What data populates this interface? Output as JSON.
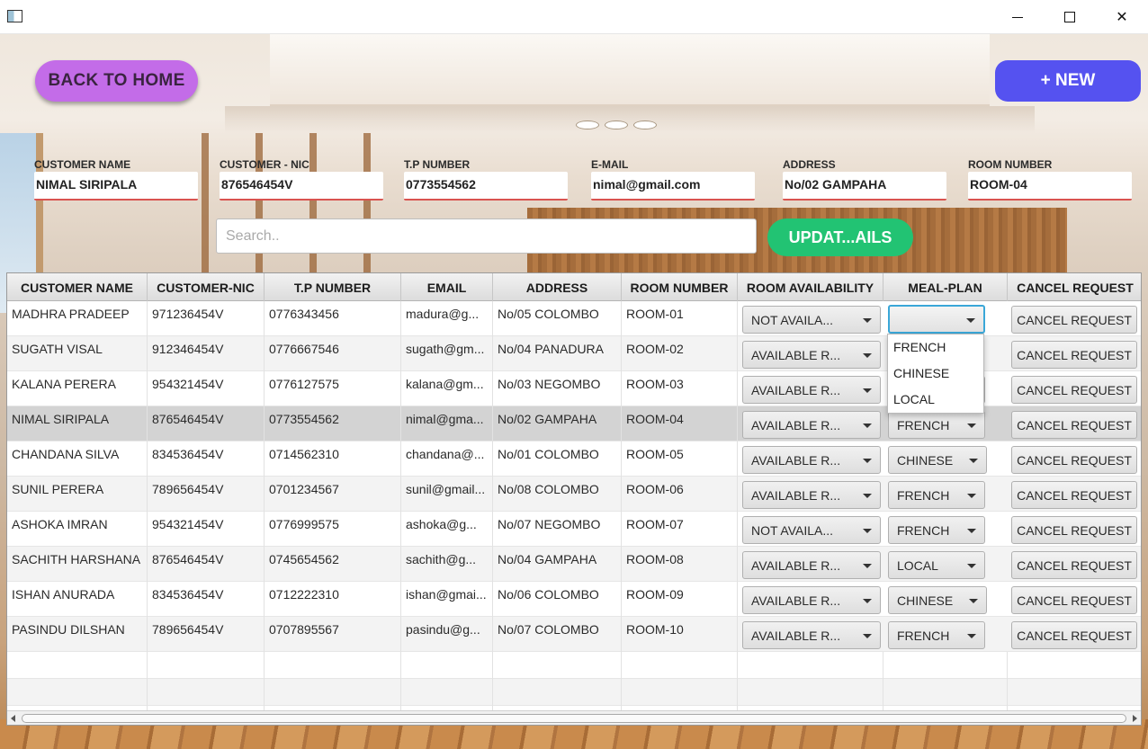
{
  "window": {
    "minimize": "—",
    "maximize": "□",
    "close": "✕"
  },
  "buttons": {
    "back": "BACK TO HOME",
    "new": "+ NEW",
    "update": "UPDAT...AILS"
  },
  "form": [
    {
      "label": "CUSTOMER NAME",
      "value": "NIMAL SIRIPALA"
    },
    {
      "label": "CUSTOMER - NIC",
      "value": "876546454V"
    },
    {
      "label": "T.P NUMBER",
      "value": "0773554562"
    },
    {
      "label": "E-MAIL",
      "value": "nimal@gmail.com"
    },
    {
      "label": "ADDRESS",
      "value": "No/02 GAMPAHA"
    },
    {
      "label": "ROOM NUMBER",
      "value": "ROOM-04"
    }
  ],
  "search": {
    "placeholder": "Search.."
  },
  "table": {
    "columns": [
      "CUSTOMER NAME",
      "CUSTOMER-NIC",
      "T.P NUMBER",
      "EMAIL",
      "ADDRESS",
      "ROOM NUMBER",
      "ROOM AVAILABILITY",
      "MEAL-PLAN",
      "CANCEL REQUEST"
    ],
    "cancel_label": "CANCEL REQUEST",
    "rows": [
      {
        "name": "MADHRA PRADEEP",
        "nic": "971236454V",
        "tp": "0776343456",
        "email": "madura@g...",
        "address": "No/05 COLOMBO",
        "room": "ROOM-01",
        "availability": "NOT AVAILA...",
        "meal": ""
      },
      {
        "name": "SUGATH VISAL",
        "nic": "912346454V",
        "tp": "0776667546",
        "email": "sugath@gm...",
        "address": "No/04 PANADURA",
        "room": "ROOM-02",
        "availability": "AVAILABLE R...",
        "meal": ""
      },
      {
        "name": "KALANA PERERA",
        "nic": "954321454V",
        "tp": "0776127575",
        "email": "kalana@gm...",
        "address": "No/03 NEGOMBO",
        "room": "ROOM-03",
        "availability": "AVAILABLE R...",
        "meal": ""
      },
      {
        "name": "NIMAL SIRIPALA",
        "nic": "876546454V",
        "tp": "0773554562",
        "email": "nimal@gma...",
        "address": "No/02 GAMPAHA",
        "room": "ROOM-04",
        "availability": "AVAILABLE R...",
        "meal": "FRENCH"
      },
      {
        "name": "CHANDANA SILVA",
        "nic": "834536454V",
        "tp": "0714562310",
        "email": "chandana@...",
        "address": "No/01 COLOMBO",
        "room": "ROOM-05",
        "availability": "AVAILABLE R...",
        "meal": "CHINESE"
      },
      {
        "name": "SUNIL PERERA",
        "nic": "789656454V",
        "tp": "0701234567",
        "email": "sunil@gmail...",
        "address": "No/08 COLOMBO",
        "room": "ROOM-06",
        "availability": "AVAILABLE R...",
        "meal": "FRENCH"
      },
      {
        "name": "ASHOKA IMRAN",
        "nic": "954321454V",
        "tp": "0776999575",
        "email": "ashoka@g...",
        "address": "No/07 NEGOMBO",
        "room": "ROOM-07",
        "availability": "NOT AVAILA...",
        "meal": "FRENCH"
      },
      {
        "name": "SACHITH HARSHANA",
        "nic": "876546454V",
        "tp": "0745654562",
        "email": "sachith@g...",
        "address": "No/04 GAMPAHA",
        "room": "ROOM-08",
        "availability": "AVAILABLE R...",
        "meal": "LOCAL"
      },
      {
        "name": "ISHAN ANURADA",
        "nic": "834536454V",
        "tp": "0712222310",
        "email": "ishan@gmai...",
        "address": "No/06 COLOMBO",
        "room": "ROOM-09",
        "availability": "AVAILABLE R...",
        "meal": "CHINESE"
      },
      {
        "name": "PASINDU DILSHAN",
        "nic": "789656454V",
        "tp": "0707895567",
        "email": "pasindu@g...",
        "address": "No/07 COLOMBO",
        "room": "ROOM-10",
        "availability": "AVAILABLE R...",
        "meal": "FRENCH"
      }
    ]
  },
  "meal_popup": {
    "options": [
      "FRENCH",
      "CHINESE",
      "LOCAL"
    ]
  },
  "colors": {
    "back_button": "#c36ce8",
    "new_button": "#5552f0",
    "update_button": "#22c373",
    "field_underline": "#d9534f"
  }
}
